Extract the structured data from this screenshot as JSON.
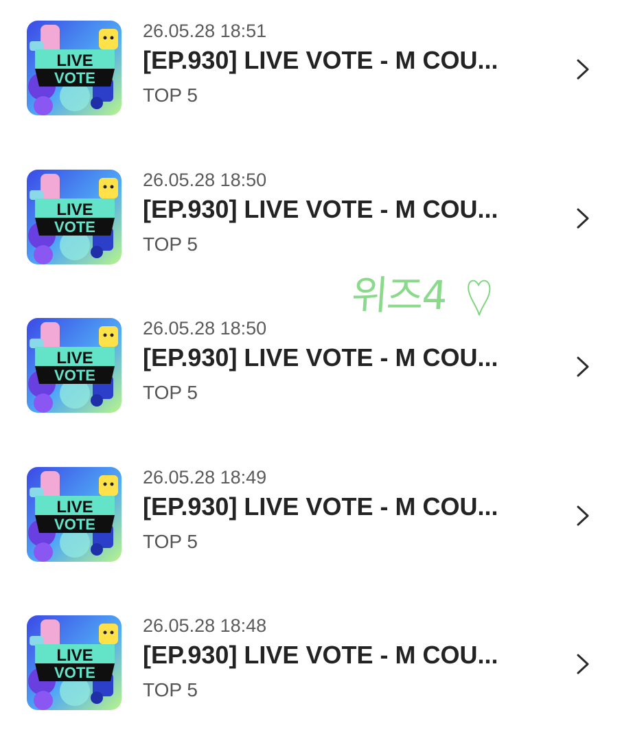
{
  "items": [
    {
      "date": "26.05.28 18:51",
      "title": "[EP.930] LIVE VOTE - M COU...",
      "subtitle": "TOP 5",
      "thumb_icon": "live-vote-thumbnail"
    },
    {
      "date": "26.05.28 18:50",
      "title": "[EP.930] LIVE VOTE - M COU...",
      "subtitle": "TOP 5",
      "thumb_icon": "live-vote-thumbnail"
    },
    {
      "date": "26.05.28 18:50",
      "title": "[EP.930] LIVE VOTE - M COU...",
      "subtitle": "TOP 5",
      "thumb_icon": "live-vote-thumbnail"
    },
    {
      "date": "26.05.28 18:49",
      "title": "[EP.930] LIVE VOTE - M COU...",
      "subtitle": "TOP 5",
      "thumb_icon": "live-vote-thumbnail"
    },
    {
      "date": "26.05.28 18:48",
      "title": "[EP.930] LIVE VOTE - M COU...",
      "subtitle": "TOP 5",
      "thumb_icon": "live-vote-thumbnail"
    }
  ],
  "thumbnail": {
    "line1": "LIVE",
    "line2": "VOTE"
  },
  "handwriting": {
    "text": "위즈4",
    "icon": "heart-doodle-icon",
    "color": "#7fd67f"
  },
  "icons": {
    "chevron": "chevron-right-icon"
  }
}
